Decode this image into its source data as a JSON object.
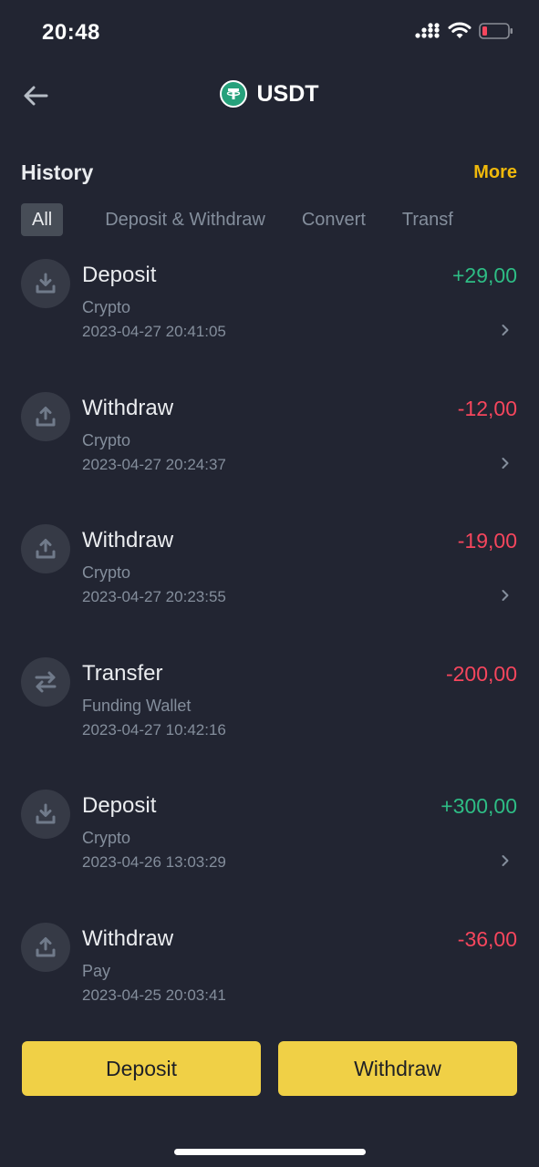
{
  "status": {
    "time": "20:48"
  },
  "nav": {
    "title": "USDT"
  },
  "history": {
    "title": "History",
    "more_label": "More",
    "tabs": [
      "All",
      "Deposit & Withdraw",
      "Convert",
      "Transf"
    ]
  },
  "transactions": [
    {
      "type": "Deposit",
      "icon": "download-icon",
      "subtitle": "Crypto",
      "time": "2023-04-27 20:41:05",
      "amount": "+29,00",
      "positive": true,
      "has_chevron": true
    },
    {
      "type": "Withdraw",
      "icon": "upload-icon",
      "subtitle": "Crypto",
      "time": "2023-04-27 20:24:37",
      "amount": "-12,00",
      "positive": false,
      "has_chevron": true
    },
    {
      "type": "Withdraw",
      "icon": "upload-icon",
      "subtitle": "Crypto",
      "time": "2023-04-27 20:23:55",
      "amount": "-19,00",
      "positive": false,
      "has_chevron": true
    },
    {
      "type": "Transfer",
      "icon": "transfer-icon",
      "subtitle": "Funding Wallet",
      "time": "2023-04-27 10:42:16",
      "amount": "-200,00",
      "positive": false,
      "has_chevron": false
    },
    {
      "type": "Deposit",
      "icon": "download-icon",
      "subtitle": "Crypto",
      "time": "2023-04-26 13:03:29",
      "amount": "+300,00",
      "positive": true,
      "has_chevron": true
    },
    {
      "type": "Withdraw",
      "icon": "upload-icon",
      "subtitle": "Pay",
      "time": "2023-04-25 20:03:41",
      "amount": "-36,00",
      "positive": false,
      "has_chevron": false
    }
  ],
  "footer": {
    "deposit_label": "Deposit",
    "withdraw_label": "Withdraw"
  },
  "colors": {
    "accent": "#f0d046",
    "positive": "#2ebd85",
    "negative": "#f6465d",
    "background": "#222532"
  }
}
